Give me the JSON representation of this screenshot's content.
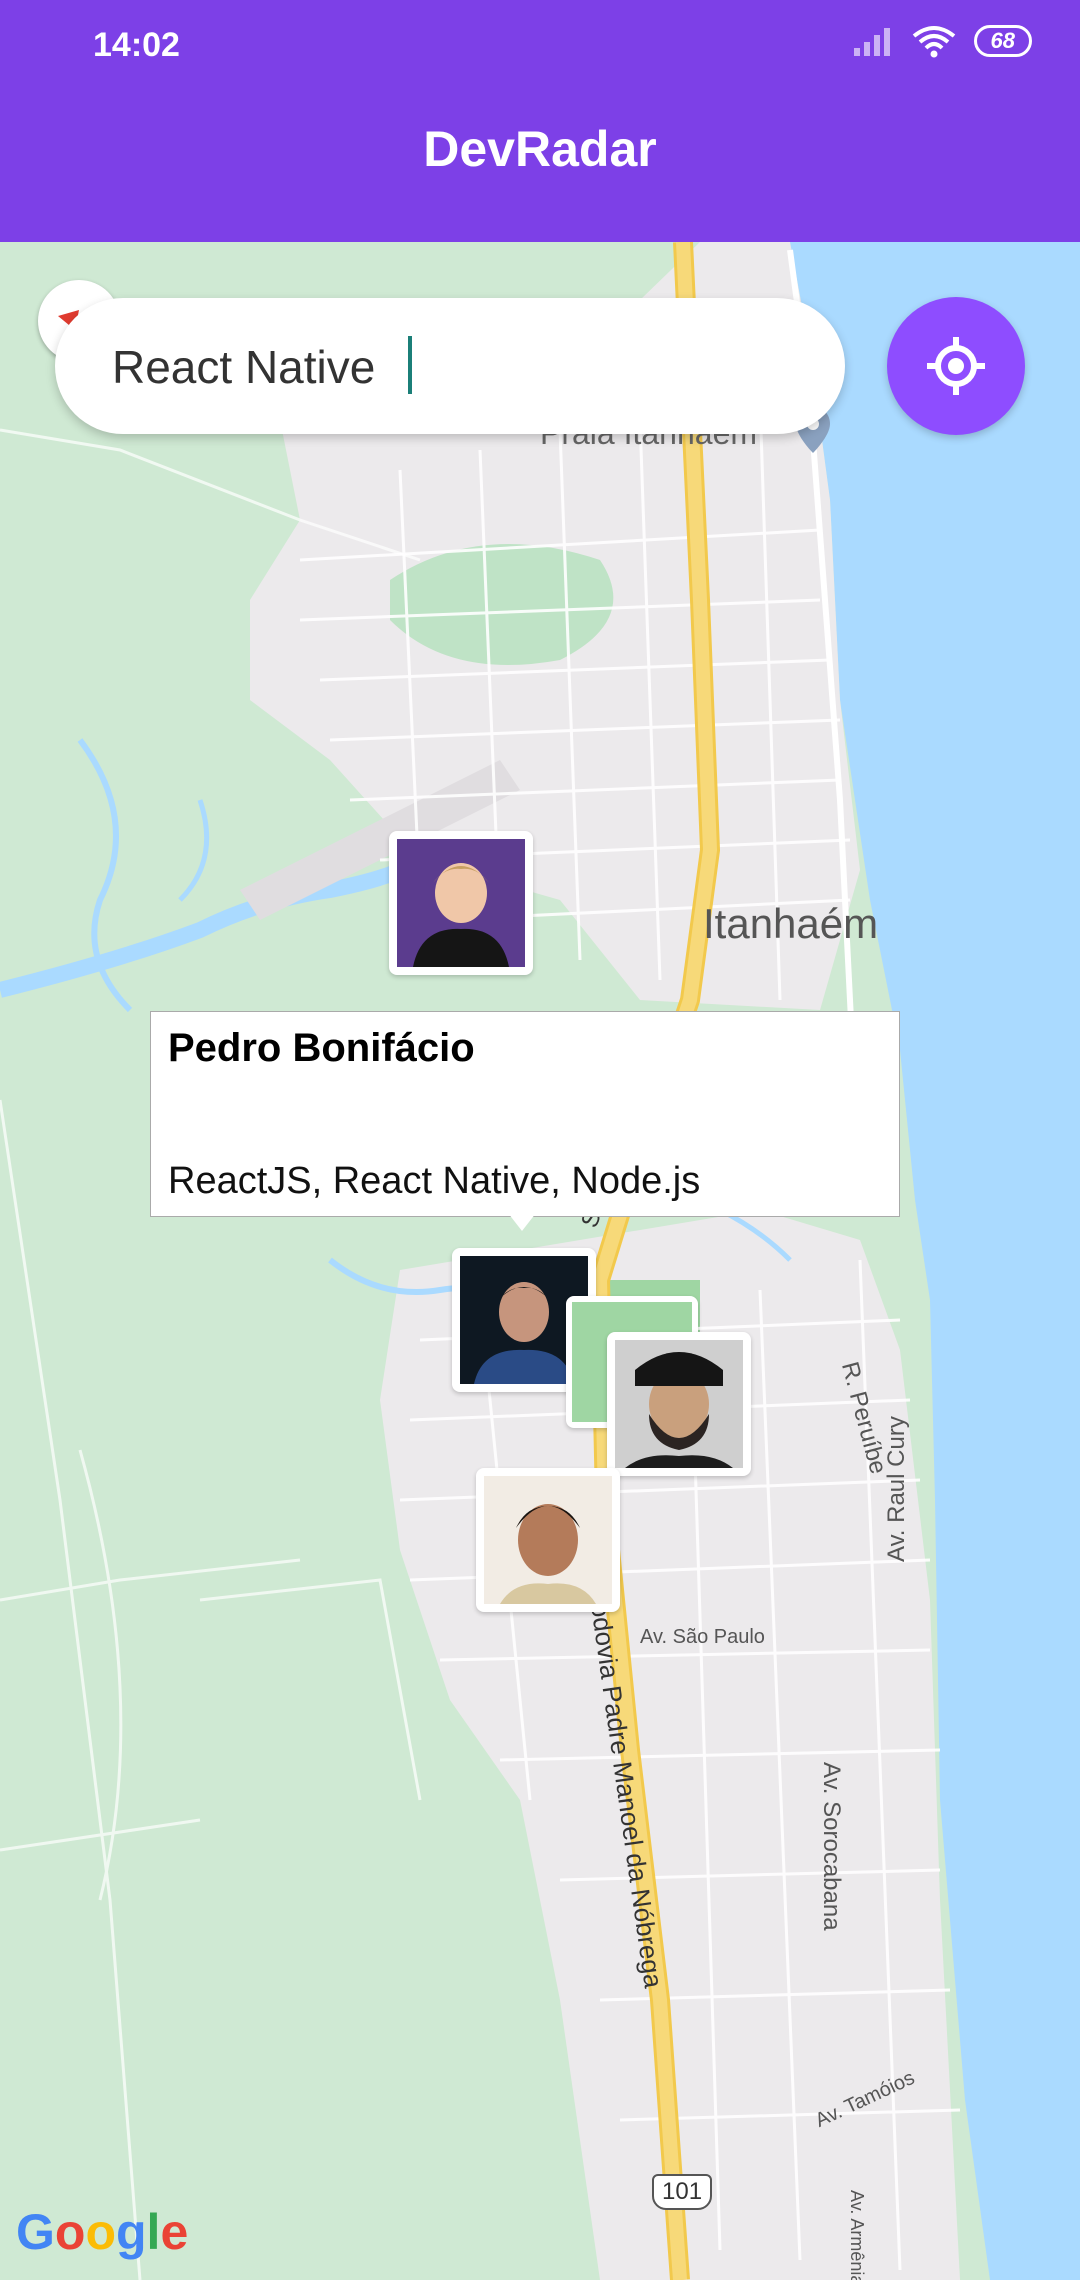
{
  "status_bar": {
    "time": "14:02",
    "battery": "68"
  },
  "header": {
    "title": "DevRadar"
  },
  "search": {
    "value": "React Native",
    "placeholder": ""
  },
  "map": {
    "labels": {
      "praia": "Praia Itanhaém",
      "city": "Itanhaém",
      "road_sp": "SP-055",
      "road_padre": "Rodovia Padre Manoel da Nóbrega",
      "av_sao_paulo": "Av. São Paulo",
      "r_peruibe": "R. Peruíbe",
      "av_raul_cury": "Av. Raul Cury",
      "av_sorocabana": "Av. Sorocabana",
      "av_tamoios": "Av. Tamóios",
      "av_armenia": "Av. Armênia",
      "shield_101": "101"
    }
  },
  "callout": {
    "name": "Pedro Bonifácio",
    "techs": "ReactJS, React Native, Node.js"
  },
  "footer": {
    "google": "Google"
  },
  "colors": {
    "brand": "#7d40e7",
    "accent": "#8e4dff",
    "map_land": "#cfe9d3",
    "map_urban": "#eceaec",
    "water": "#aadaff",
    "highway": "#f7d979"
  }
}
